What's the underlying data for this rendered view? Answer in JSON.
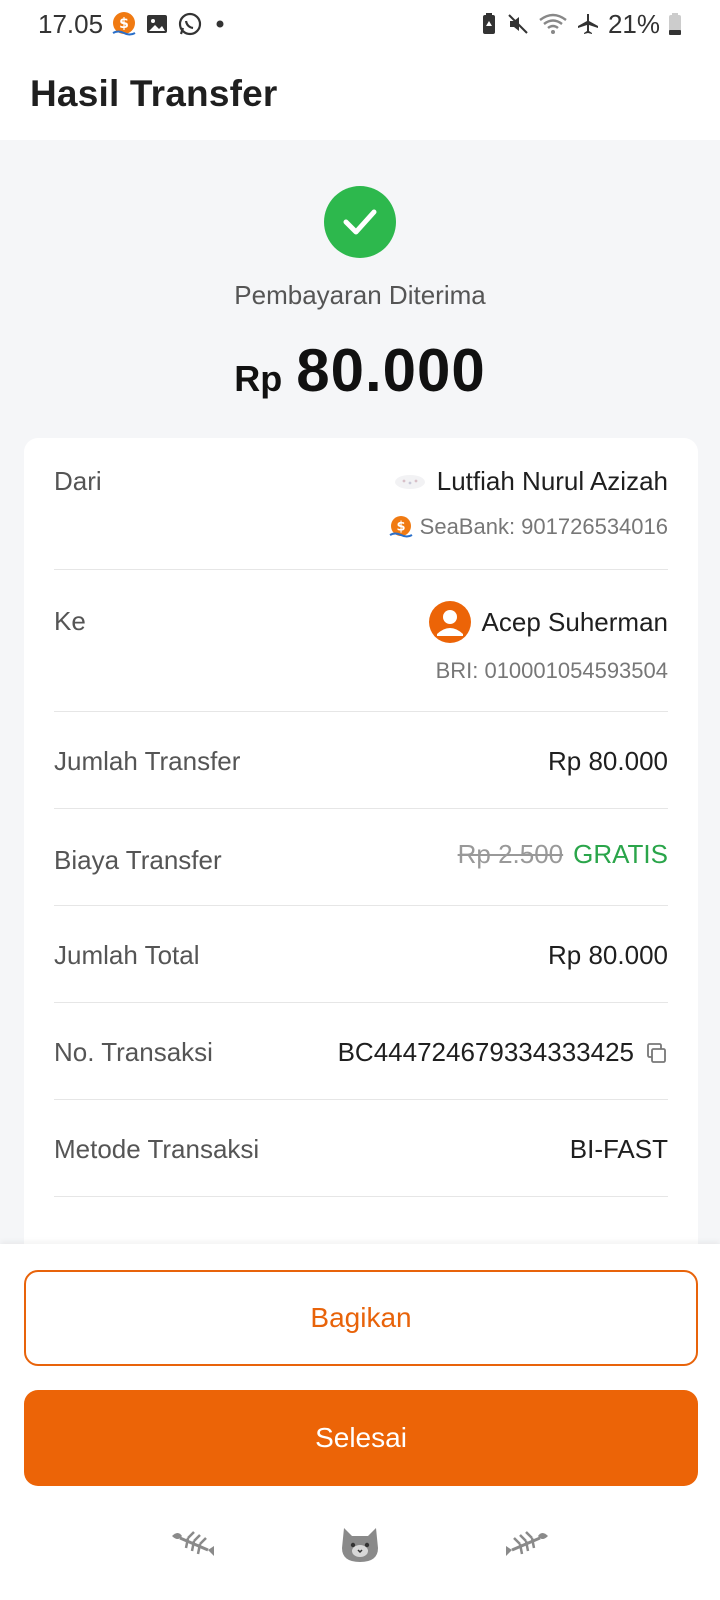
{
  "status_bar": {
    "time": "17.05",
    "battery": "21%"
  },
  "header": {
    "title": "Hasil Transfer"
  },
  "hero": {
    "status": "Pembayaran Diterima",
    "currency": "Rp",
    "amount": "80.000"
  },
  "details": {
    "from": {
      "label": "Dari",
      "name": "Lutfiah Nurul Azizah",
      "account": "SeaBank: 901726534016"
    },
    "to": {
      "label": "Ke",
      "name": "Acep Suherman",
      "account": "BRI: 010001054593504"
    },
    "transfer_amount": {
      "label": "Jumlah Transfer",
      "value": "Rp 80.000"
    },
    "fee": {
      "label": "Biaya Transfer",
      "original": "Rp 2.500",
      "value": "GRATIS"
    },
    "total": {
      "label": "Jumlah Total",
      "value": "Rp 80.000"
    },
    "transaction_no": {
      "label": "No. Transaksi",
      "value": "BC444724679334333425"
    },
    "method": {
      "label": "Metode Transaksi",
      "value": "BI-FAST"
    }
  },
  "actions": {
    "share_label": "Bagikan",
    "done_label": "Selesai"
  },
  "colors": {
    "accent": "#ec6407",
    "success": "#2db84d"
  },
  "icons": [
    "seabank-icon",
    "gallery-icon",
    "whatsapp-icon",
    "check-icon",
    "avatar-icon",
    "copy-icon",
    "fishbone-icon",
    "cat-icon"
  ]
}
